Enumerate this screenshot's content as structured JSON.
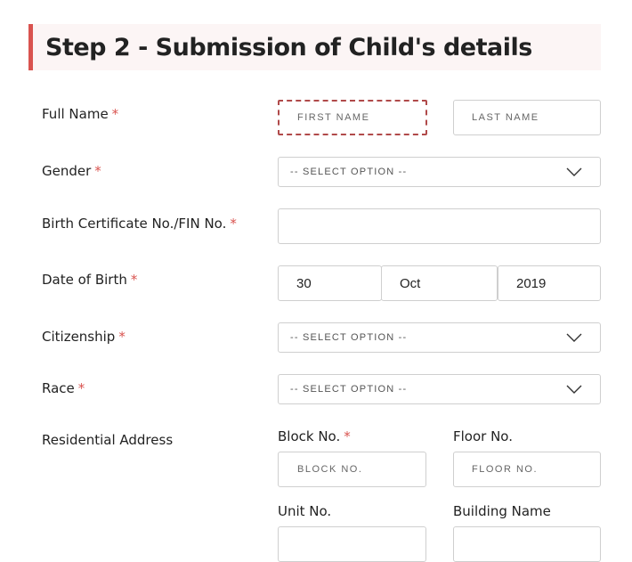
{
  "header": {
    "title": "Step 2 - Submission of Child's details"
  },
  "colors": {
    "accent": "#d9534f",
    "header_bg": "#fcf5f5",
    "border": "#cfcfcf"
  },
  "required_mark": "*",
  "form": {
    "full_name": {
      "label": "Full Name",
      "first_placeholder": "FIRST NAME",
      "last_placeholder": "LAST NAME"
    },
    "gender": {
      "label": "Gender",
      "selected": "-- SELECT OPTION --"
    },
    "birth_cert": {
      "label": "Birth Certificate No./FIN No.",
      "value": ""
    },
    "dob": {
      "label": "Date of Birth",
      "day": "30",
      "month": "Oct",
      "year": "2019"
    },
    "citizenship": {
      "label": "Citizenship",
      "selected": "-- SELECT OPTION --"
    },
    "race": {
      "label": "Race",
      "selected": "-- SELECT OPTION --"
    },
    "address": {
      "label": "Residential Address",
      "block_label": "Block No.",
      "block_placeholder": "BLOCK NO.",
      "floor_label": "Floor No.",
      "floor_placeholder": "FLOOR NO.",
      "unit_label": "Unit No.",
      "building_label": "Building Name"
    }
  }
}
